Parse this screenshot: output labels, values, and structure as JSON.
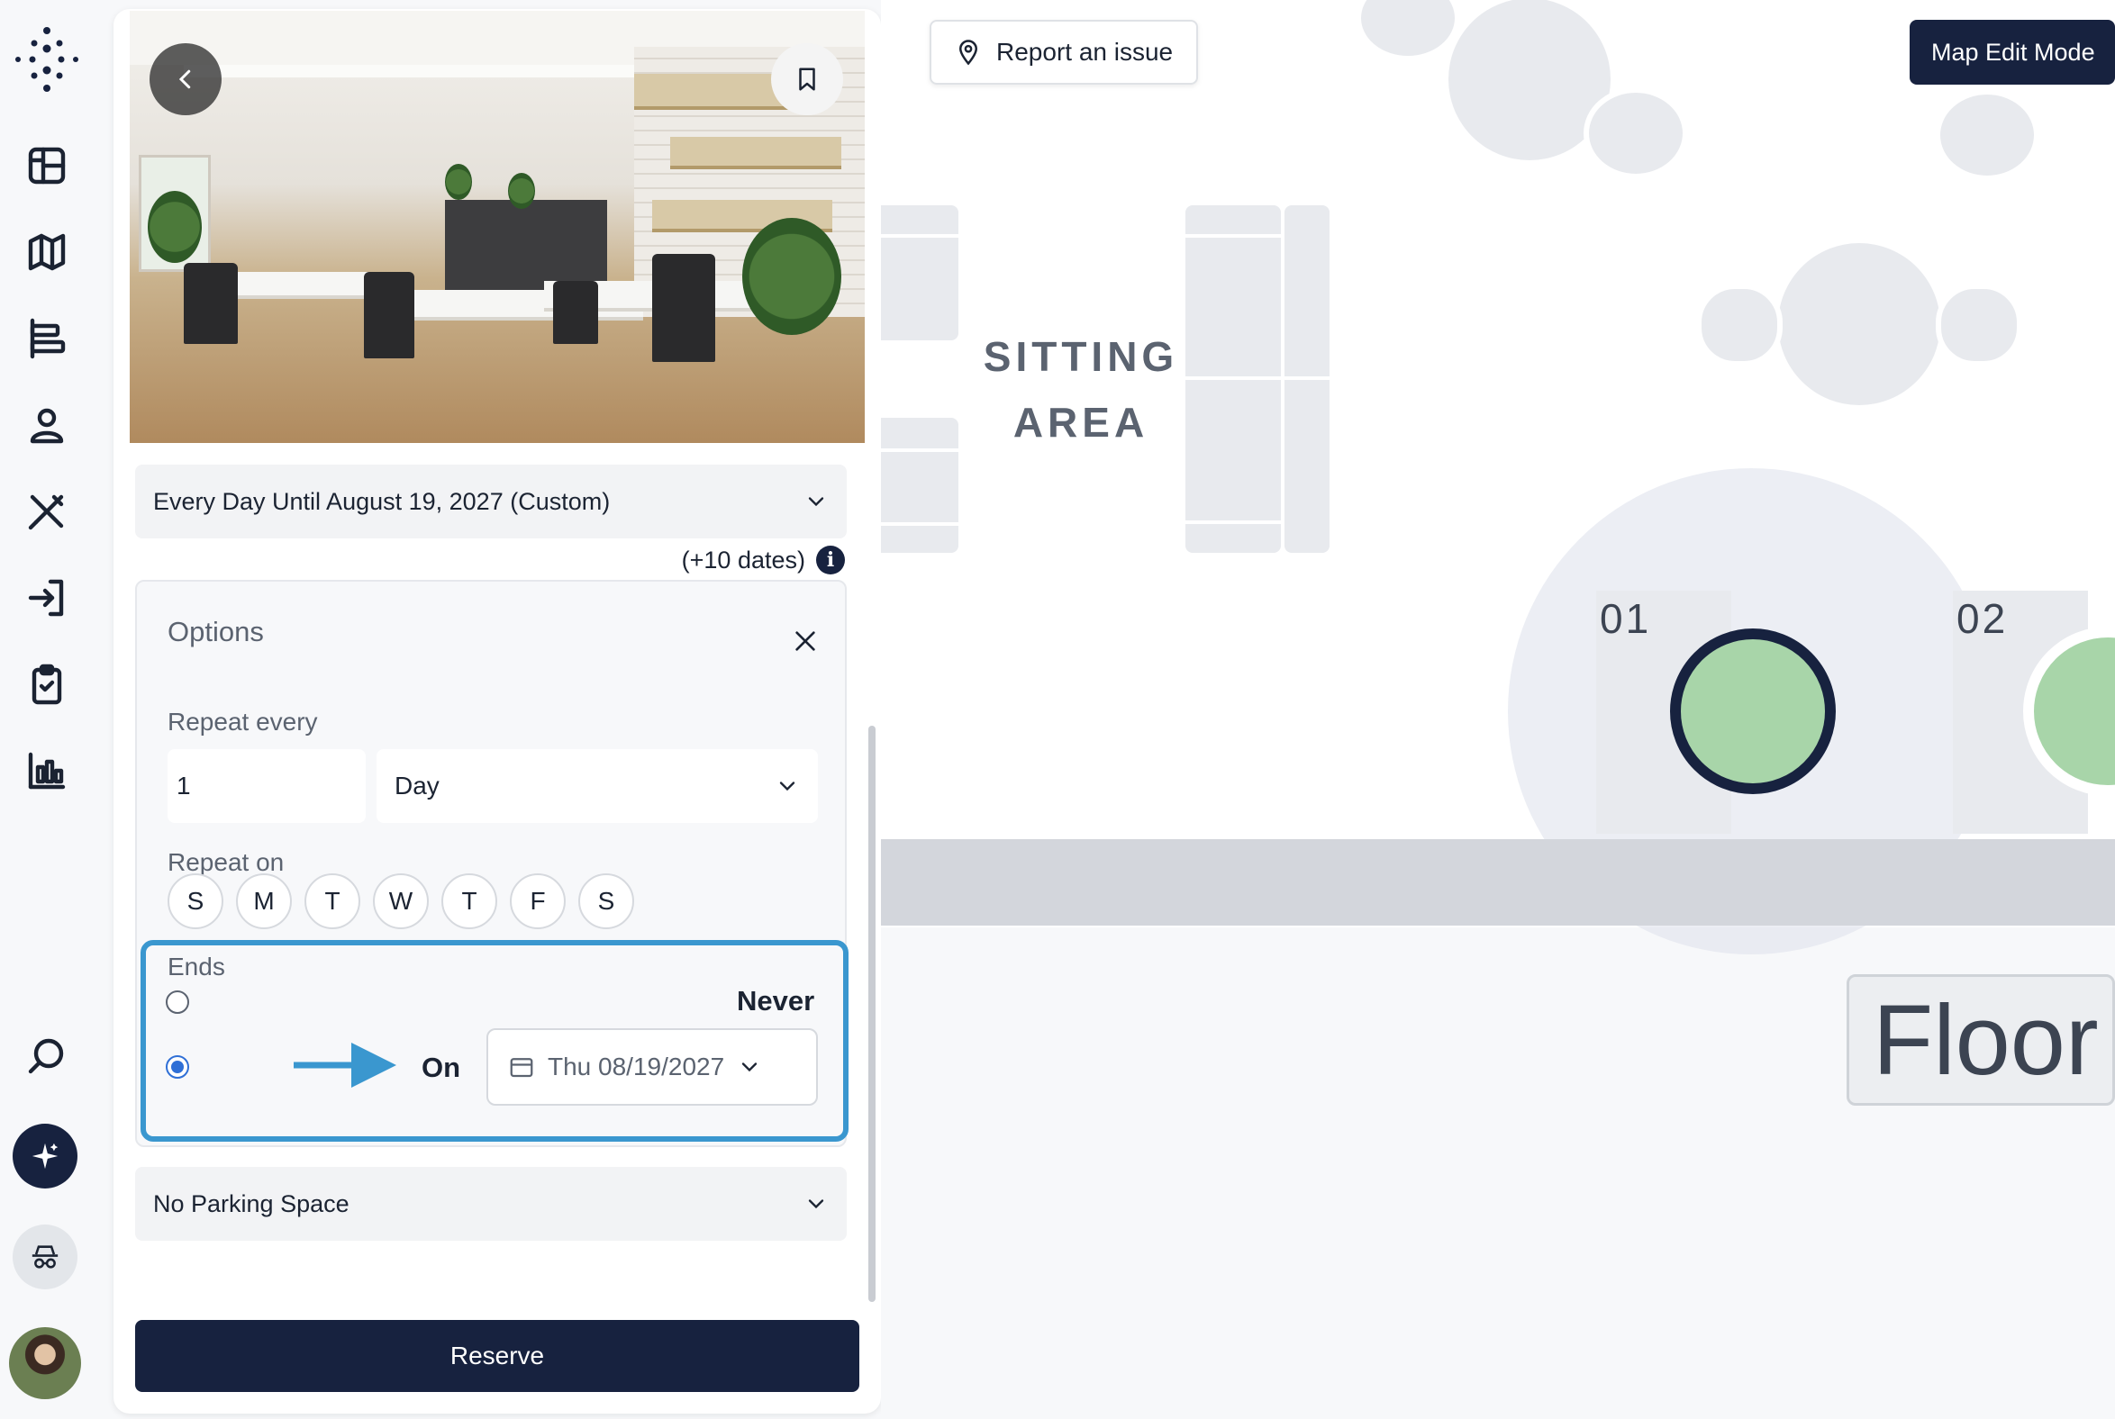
{
  "nav": {
    "items": [
      "layout-icon",
      "map-icon",
      "timeline-icon",
      "user-icon",
      "tools-icon",
      "sign-in-icon",
      "clipboard-check-icon",
      "bar-chart-icon"
    ],
    "bottom": [
      "search-icon",
      "sparkle-icon",
      "incognito-icon"
    ]
  },
  "panel": {
    "recurrence_select": "Every Day Until August 19, 2027 (Custom)",
    "dates_note": "(+10 dates)",
    "info_glyph": "i",
    "options": {
      "title": "Options",
      "repeat_every_label": "Repeat every",
      "repeat_every_value": "1",
      "repeat_unit": "Day",
      "repeat_on_label": "Repeat on",
      "days": [
        "S",
        "M",
        "T",
        "W",
        "T",
        "F",
        "S"
      ],
      "ends_label": "Ends",
      "never_label": "Never",
      "on_label": "On",
      "end_date": "Thu 08/19/2027"
    },
    "parking_select": "No Parking Space",
    "reserve_label": "Reserve"
  },
  "map": {
    "report_button": "Report an issue",
    "edit_button": "Map Edit Mode",
    "sitting_area_line1": "SITTING",
    "sitting_area_line2": "AREA",
    "seat_01": "01",
    "seat_02": "02",
    "floor_label": "Floor"
  },
  "colors": {
    "navy": "#17223f",
    "highlight": "#3a97cf",
    "seat_available": "#a8d5a9",
    "radio_selected": "#2f6fd6"
  }
}
